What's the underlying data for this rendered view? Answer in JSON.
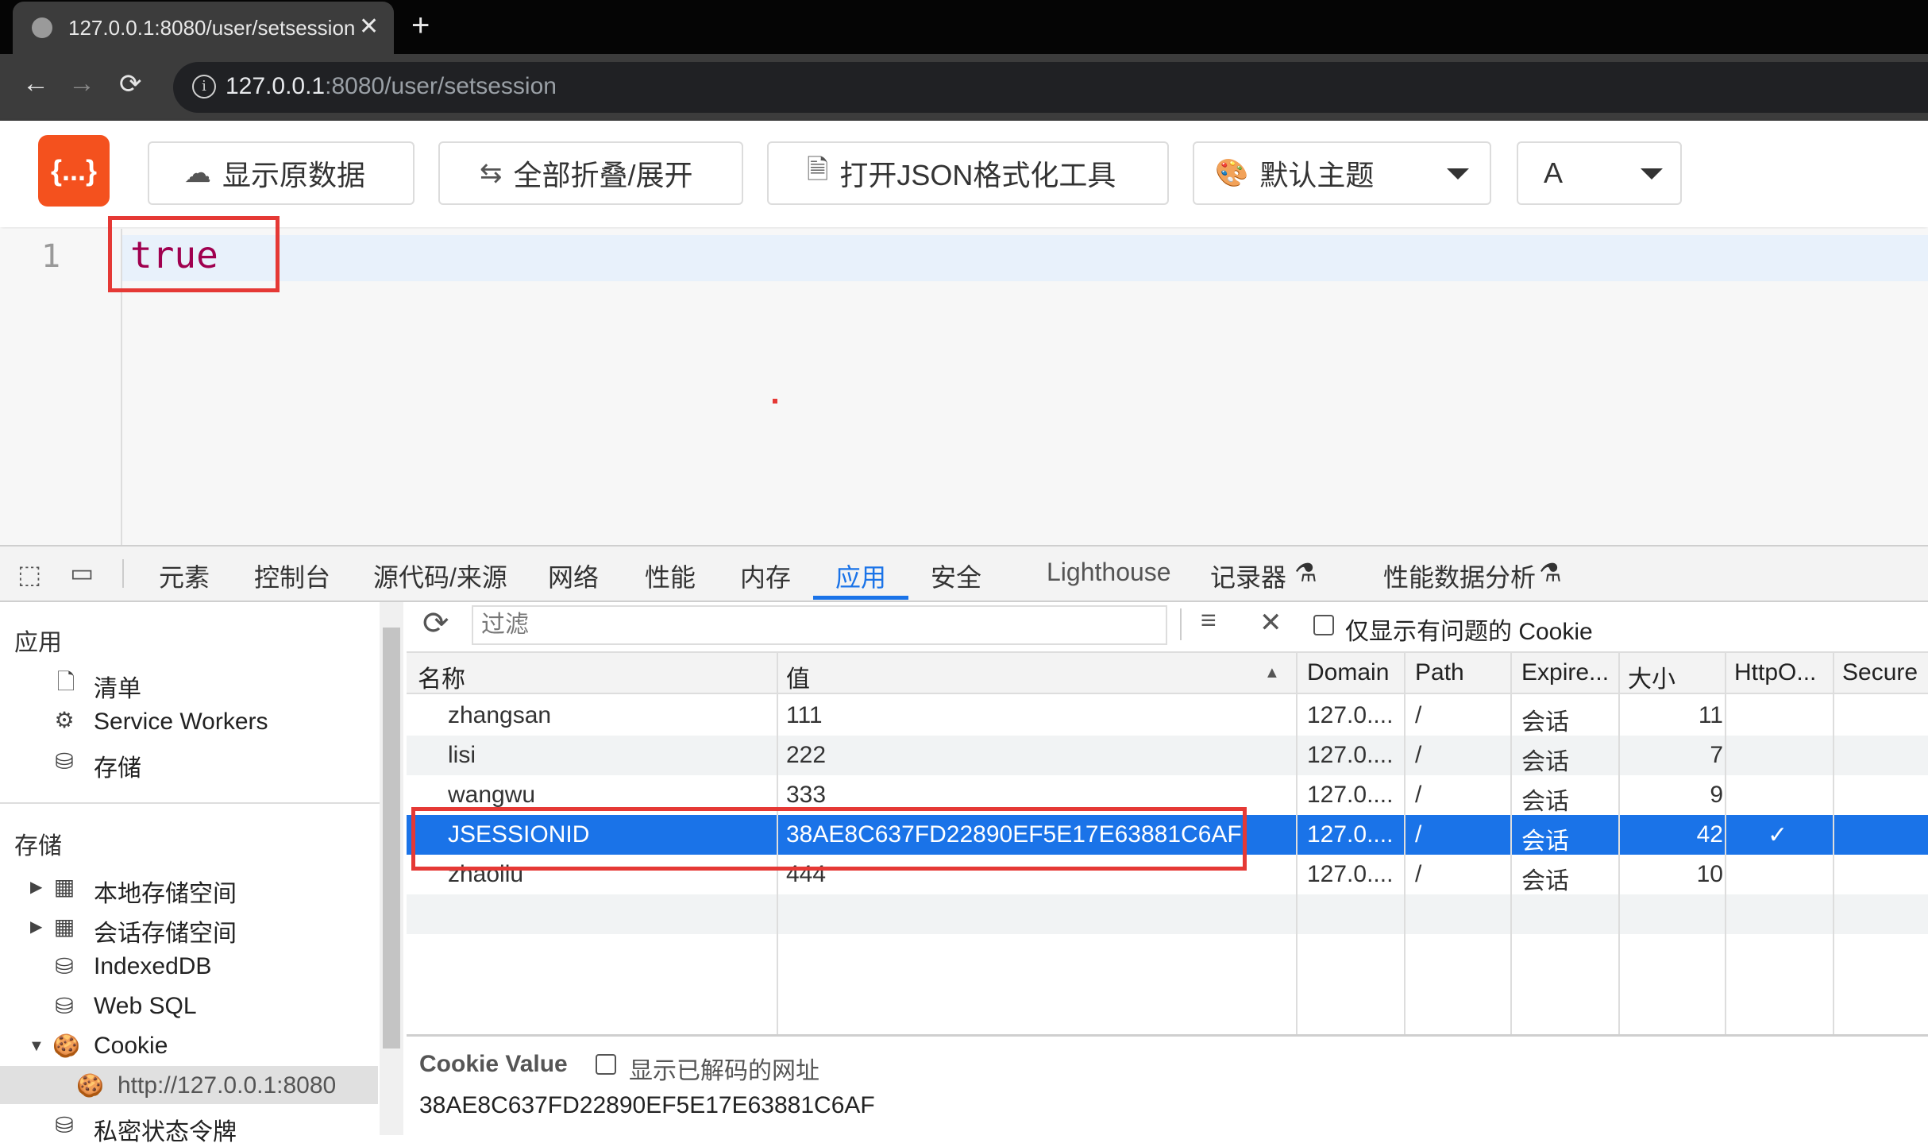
{
  "browser": {
    "tab_title": "127.0.0.1:8080/user/setsession",
    "url_host": "127.0.0.1",
    "url_rest": ":8080/user/setsession"
  },
  "json_viewer": {
    "raw_button": "显示原数据",
    "fold_button": "全部折叠/展开",
    "format_tool_button": "打开JSON格式化工具",
    "theme_select": "默认主题",
    "font_select": "A",
    "logo": "{...}",
    "line_number": "1",
    "content": "true"
  },
  "devtools": {
    "tabs": [
      "元素",
      "控制台",
      "源代码/来源",
      "网络",
      "性能",
      "内存",
      "应用",
      "安全",
      "Lighthouse",
      "记录器",
      "性能数据分析"
    ],
    "active_tab": "应用",
    "sidebar": {
      "app_header": "应用",
      "app_items": [
        "清单",
        "Service Workers",
        "存储"
      ],
      "storage_header": "存储",
      "storage_items": [
        "本地存储空间",
        "会话存储空间",
        "IndexedDB",
        "Web SQL",
        "Cookie",
        "http://127.0.0.1:8080",
        "私密状态令牌"
      ]
    },
    "cookies": {
      "filter_placeholder": "过滤",
      "only_issues_label": "仅显示有问题的 Cookie",
      "columns": [
        "名称",
        "值",
        "Domain",
        "Path",
        "Expire...",
        "大小",
        "HttpO...",
        "Secure"
      ],
      "rows": [
        {
          "name": "zhangsan",
          "value": "111",
          "domain": "127.0....",
          "path": "/",
          "expires": "会话",
          "size": "11",
          "httponly": "",
          "secure": ""
        },
        {
          "name": "lisi",
          "value": "222",
          "domain": "127.0....",
          "path": "/",
          "expires": "会话",
          "size": "7",
          "httponly": "",
          "secure": ""
        },
        {
          "name": "wangwu",
          "value": "333",
          "domain": "127.0....",
          "path": "/",
          "expires": "会话",
          "size": "9",
          "httponly": "",
          "secure": ""
        },
        {
          "name": "JSESSIONID",
          "value": "38AE8C637FD22890EF5E17E63881C6AF",
          "domain": "127.0....",
          "path": "/",
          "expires": "会话",
          "size": "42",
          "httponly": "✓",
          "secure": ""
        },
        {
          "name": "zhaoliu",
          "value": "444",
          "domain": "127.0....",
          "path": "/",
          "expires": "会话",
          "size": "10",
          "httponly": "",
          "secure": ""
        }
      ],
      "selected_row": 3,
      "cookie_value_label": "Cookie Value",
      "show_decoded_label": "显示已解码的网址",
      "cookie_value": "38AE8C637FD22890EF5E17E63881C6AF"
    }
  },
  "colors": {
    "accent": "#1a73e8",
    "highlight_box": "#e53935",
    "logo_bg": "#f4511e",
    "json_value": "#a0004f"
  }
}
